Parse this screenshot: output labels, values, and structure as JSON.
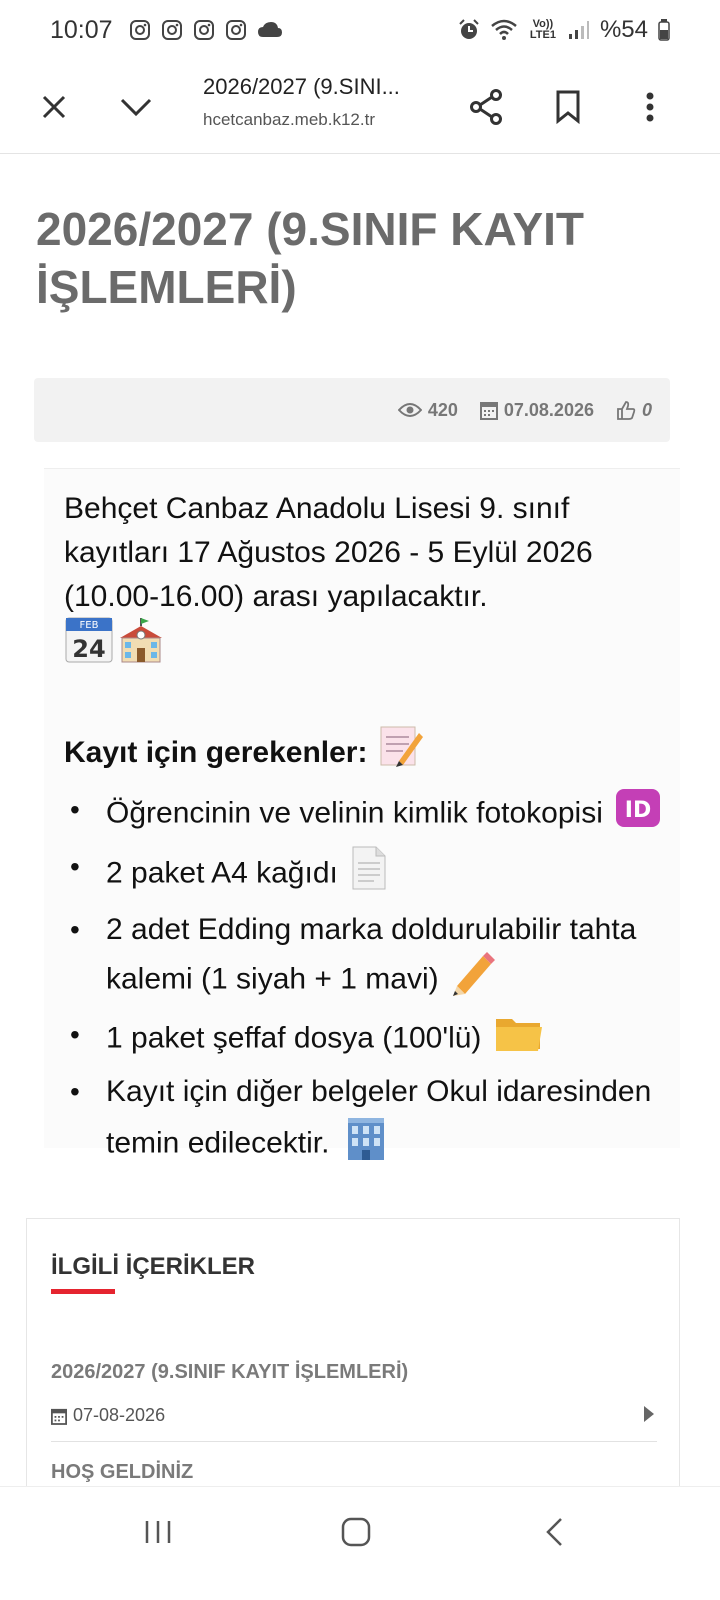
{
  "status_bar": {
    "time": "10:07",
    "battery": "%54",
    "icons": [
      "instagram-icon",
      "instagram-icon",
      "instagram-icon",
      "instagram-icon",
      "cloud-icon",
      "alarm-icon",
      "wifi-icon",
      "volte-icon",
      "signal-icon",
      "battery-icon"
    ],
    "volte_label": "Vo)) LTE1"
  },
  "browser": {
    "page_title": "2026/2027 (9.SINI...",
    "url": "hcetcanbaz.meb.k12.tr"
  },
  "article": {
    "title": "2026/2027 (9.SINIF KAYIT İŞLEMLERİ)",
    "views": "420",
    "date": "07.08.2026",
    "likes": "0"
  },
  "notice": {
    "intro": "Behçet Canbaz Anadolu Lisesi 9. sınıf kayıtları 17 Ağustos 2026 - 5 Eylül 2026 (10.00-16.00) arası yapılacaktır.",
    "calendar_month": "FEB",
    "calendar_day": "24",
    "requirements_heading": "Kayıt için gerekenler:",
    "id_badge": "ID",
    "requirements": [
      "Öğrencinin ve velinin kimlik fotokopisi",
      "2 paket A4 kağıdı",
      "2 adet Edding marka doldurulabilir tahta kalemi (1 siyah + 1 mavi)",
      "1 paket şeffaf dosya (100'lü)",
      "Kayıt için diğer belgeler Okul idaresinden temin edilecektir."
    ]
  },
  "related": {
    "heading": "İLGİLİ İÇERİKLER",
    "items": [
      {
        "title": "2026/2027 (9.SINIF KAYIT İŞLEMLERİ)",
        "date": "07-08-2026"
      },
      {
        "title": "HOŞ GELDİNİZ"
      }
    ]
  },
  "colors": {
    "accent": "#e5242f",
    "title_gray": "#6b6b6b",
    "meta_bg": "#f2f2f2"
  }
}
